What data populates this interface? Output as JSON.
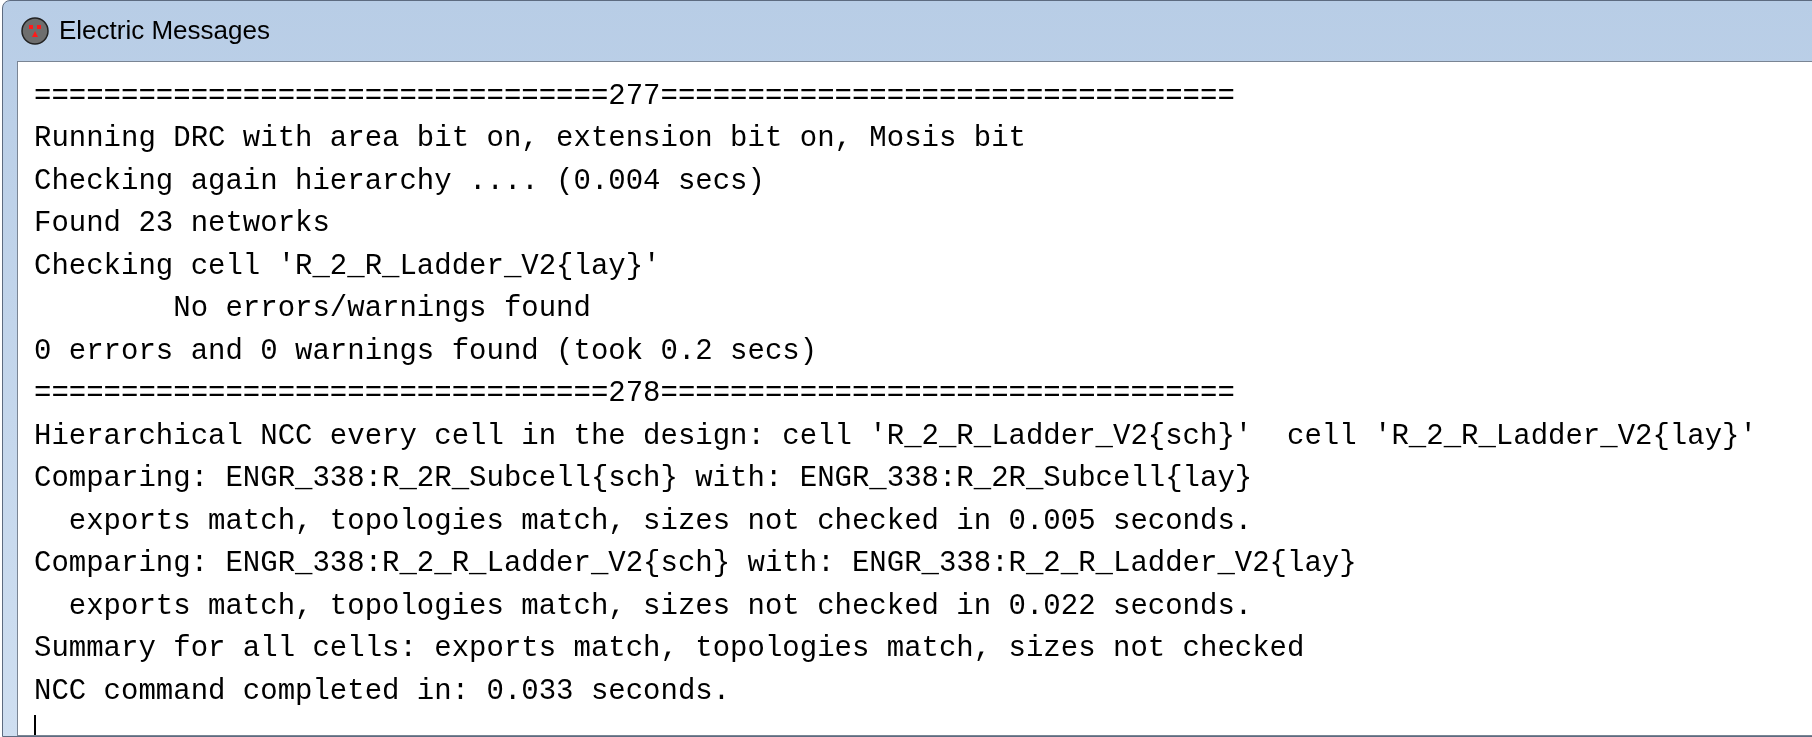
{
  "window": {
    "title": "Electric Messages"
  },
  "lines": [
    "=================================277=================================",
    "Running DRC with area bit on, extension bit on, Mosis bit",
    "Checking again hierarchy .... (0.004 secs)",
    "Found 23 networks",
    "Checking cell 'R_2_R_Ladder_V2{lay}'",
    "        No errors/warnings found",
    "0 errors and 0 warnings found (took 0.2 secs)",
    "=================================278=================================",
    "Hierarchical NCC every cell in the design: cell 'R_2_R_Ladder_V2{sch}'  cell 'R_2_R_Ladder_V2{lay}'",
    "Comparing: ENGR_338:R_2R_Subcell{sch} with: ENGR_338:R_2R_Subcell{lay}",
    "  exports match, topologies match, sizes not checked in 0.005 seconds.",
    "Comparing: ENGR_338:R_2_R_Ladder_V2{sch} with: ENGR_338:R_2_R_Ladder_V2{lay}",
    "  exports match, topologies match, sizes not checked in 0.022 seconds.",
    "Summary for all cells: exports match, topologies match, sizes not checked",
    "NCC command completed in: 0.033 seconds."
  ]
}
